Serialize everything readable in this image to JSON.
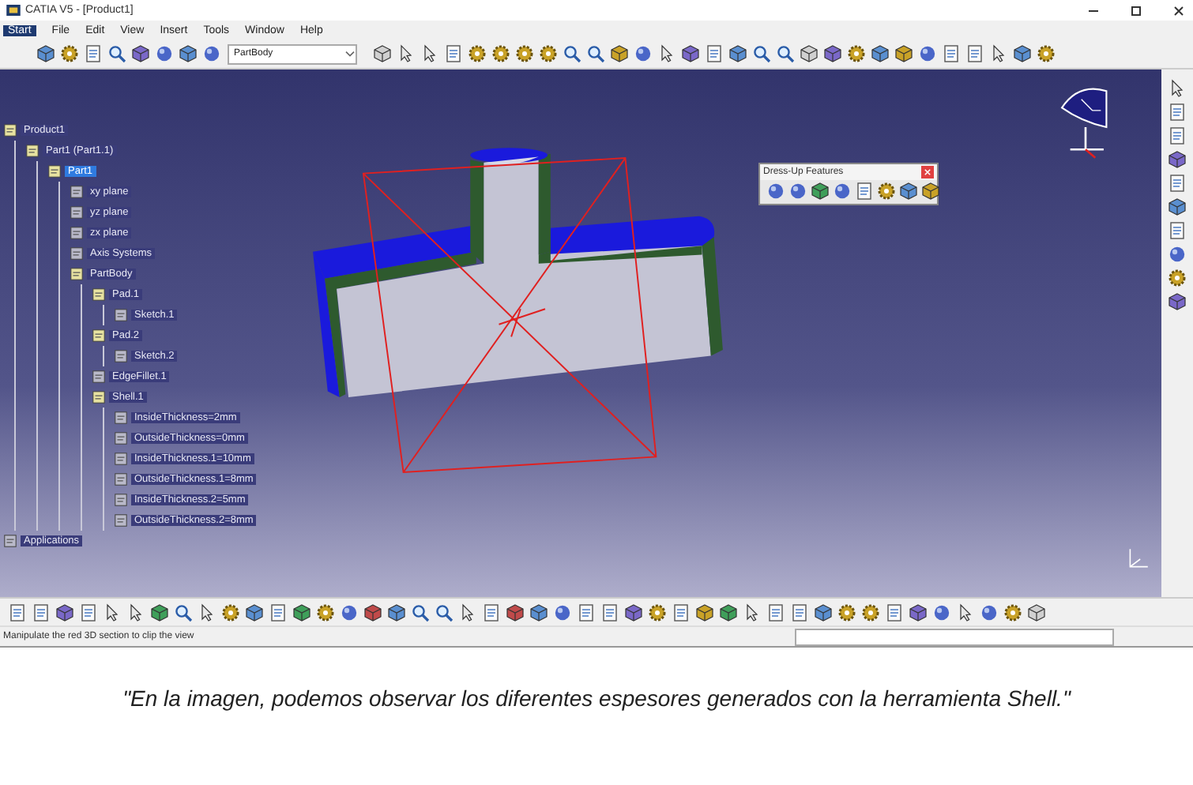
{
  "window": {
    "title": "CATIA V5 - [Product1]"
  },
  "menu": [
    {
      "label": "Start",
      "selected": true
    },
    {
      "label": "File",
      "selected": false
    },
    {
      "label": "Edit",
      "selected": false
    },
    {
      "label": "View",
      "selected": false
    },
    {
      "label": "Insert",
      "selected": false
    },
    {
      "label": "Tools",
      "selected": false
    },
    {
      "label": "Window",
      "selected": false
    },
    {
      "label": "Help",
      "selected": false
    }
  ],
  "toolbar": {
    "body_field": {
      "value": "PartBody"
    }
  },
  "tree": [
    {
      "label": "Product1",
      "selected": false,
      "children": [
        {
          "label": "Part1 (Part1.1)",
          "selected": false,
          "children": [
            {
              "label": "Part1",
              "selected": true,
              "children": [
                {
                  "label": "xy plane",
                  "selected": false
                },
                {
                  "label": "yz plane",
                  "selected": false
                },
                {
                  "label": "zx plane",
                  "selected": false
                },
                {
                  "label": "Axis Systems",
                  "selected": false
                },
                {
                  "label": "PartBody",
                  "selected": false,
                  "children": [
                    {
                      "label": "Pad.1",
                      "selected": false,
                      "children": [
                        {
                          "label": "Sketch.1",
                          "selected": false
                        }
                      ]
                    },
                    {
                      "label": "Pad.2",
                      "selected": false,
                      "children": [
                        {
                          "label": "Sketch.2",
                          "selected": false
                        }
                      ]
                    },
                    {
                      "label": "EdgeFillet.1",
                      "selected": false
                    },
                    {
                      "label": "Shell.1",
                      "selected": false,
                      "children": [
                        {
                          "label": "InsideThickness=2mm",
                          "selected": false
                        },
                        {
                          "label": "OutsideThickness=0mm",
                          "selected": false
                        },
                        {
                          "label": "InsideThickness.1=10mm",
                          "selected": false
                        },
                        {
                          "label": "OutsideThickness.1=8mm",
                          "selected": false
                        },
                        {
                          "label": "InsideThickness.2=5mm",
                          "selected": false
                        },
                        {
                          "label": "OutsideThickness.2=8mm",
                          "selected": false
                        }
                      ]
                    }
                  ]
                }
              ]
            }
          ]
        }
      ]
    },
    {
      "label": "Applications",
      "selected": false
    }
  ],
  "dress_up_toolbar": {
    "title": "Dress-Up Features"
  },
  "status_bar": {
    "message": "Manipulate the red 3D section to clip the view"
  },
  "caption": "\"En la imagen, podemos observar los diferentes espesores generados con la herramienta Shell.\""
}
